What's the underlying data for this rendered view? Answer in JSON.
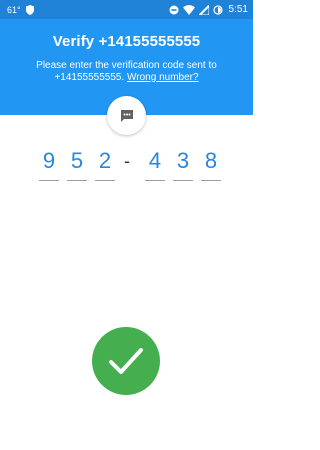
{
  "status_bar": {
    "temperature": "61°",
    "time": "5:51",
    "icons": [
      "shield-icon",
      "do-not-disturb-icon",
      "wifi-icon",
      "signal-icon",
      "battery-icon"
    ]
  },
  "header": {
    "title": "Verify +14155555555",
    "message": "Please enter the verification code sent to +14155555555.",
    "wrong_number_link": "Wrong number?"
  },
  "code": {
    "digits": [
      "9",
      "5",
      "2",
      "4",
      "3",
      "8"
    ],
    "separator": "-"
  },
  "icons": {
    "bubble": "message-bubble-icon",
    "success": "checkmark-icon"
  },
  "colors": {
    "status_bar": "#1f82d6",
    "header": "#2196f3",
    "digit": "#2a86dd",
    "success": "#45af4f"
  }
}
